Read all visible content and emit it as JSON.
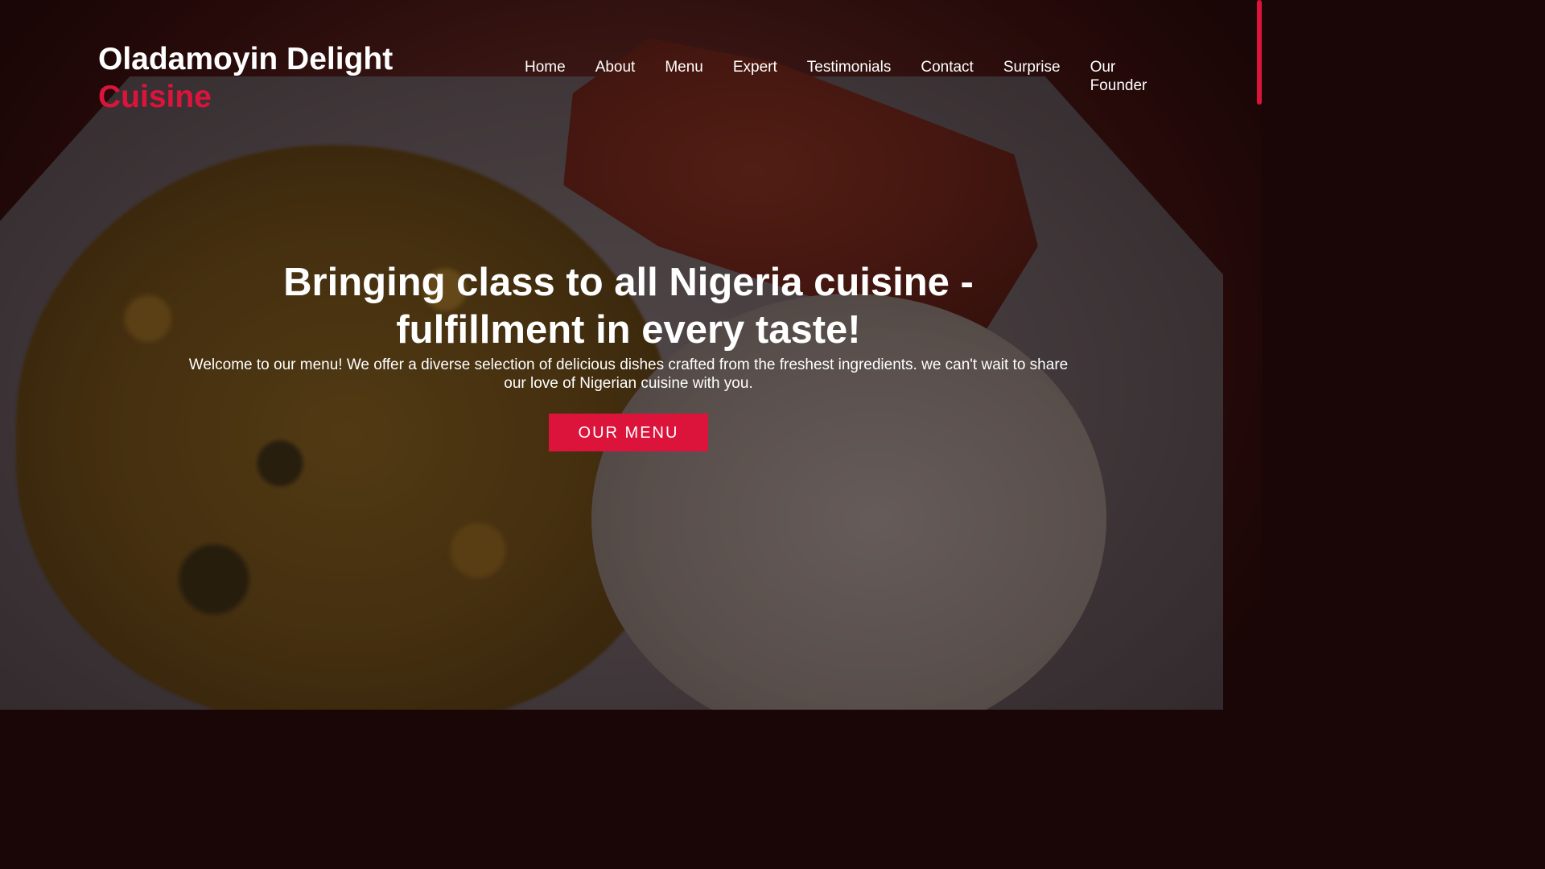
{
  "brand": {
    "name": "Oladamoyin Delight",
    "accent": "Cuisine",
    "accent_color": "#dc143c"
  },
  "nav": {
    "items": [
      "Home",
      "About",
      "Menu",
      "Expert",
      "Testimonials",
      "Contact",
      "Surprise",
      "Our Founder"
    ]
  },
  "hero": {
    "heading": "Bringing class to all Nigeria cuisine - fulfillment in every taste!",
    "subtext": "Welcome to our menu! We offer a diverse selection of delicious dishes crafted from the freshest ingredients. we can't wait to share our love of Nigerian cuisine with you.",
    "cta_label": "OUR MENU",
    "background_image": "egusi-soup-and-pounded-yam-plate"
  }
}
